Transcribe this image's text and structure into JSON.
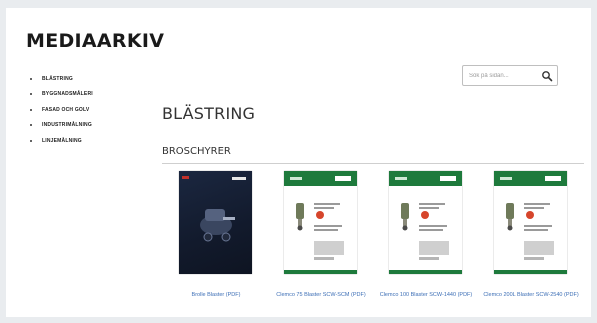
{
  "header": {
    "title": "MEDIAARKIV"
  },
  "sidebar": {
    "items": [
      {
        "label": "BLÄSTRING"
      },
      {
        "label": "BYGGNADSMÅLERI"
      },
      {
        "label": "FASAD OCH GOLV"
      },
      {
        "label": "INDUSTRIMÅLNING"
      },
      {
        "label": "LINJEMÅLNING"
      }
    ]
  },
  "search": {
    "placeholder": "Sök på sidan...",
    "icon": "search-icon"
  },
  "main": {
    "section_title": "BLÄSTRING",
    "subsection_title": "BROSCHYRER",
    "brochures": [
      {
        "caption": "Brolle Blaster (PDF)",
        "style": "dark"
      },
      {
        "caption": "Clemco 75 Blaster SCW-SCM (PDF)",
        "style": "light"
      },
      {
        "caption": "Clemco 100 Blaster SCW-1440 (PDF)",
        "style": "light"
      },
      {
        "caption": "Clemco 200L Blaster SCW-2540 (PDF)",
        "style": "light"
      }
    ]
  },
  "colors": {
    "accent_green": "#1e7a3c",
    "link_blue": "#3d6fb6",
    "background": "#e9ecef"
  }
}
